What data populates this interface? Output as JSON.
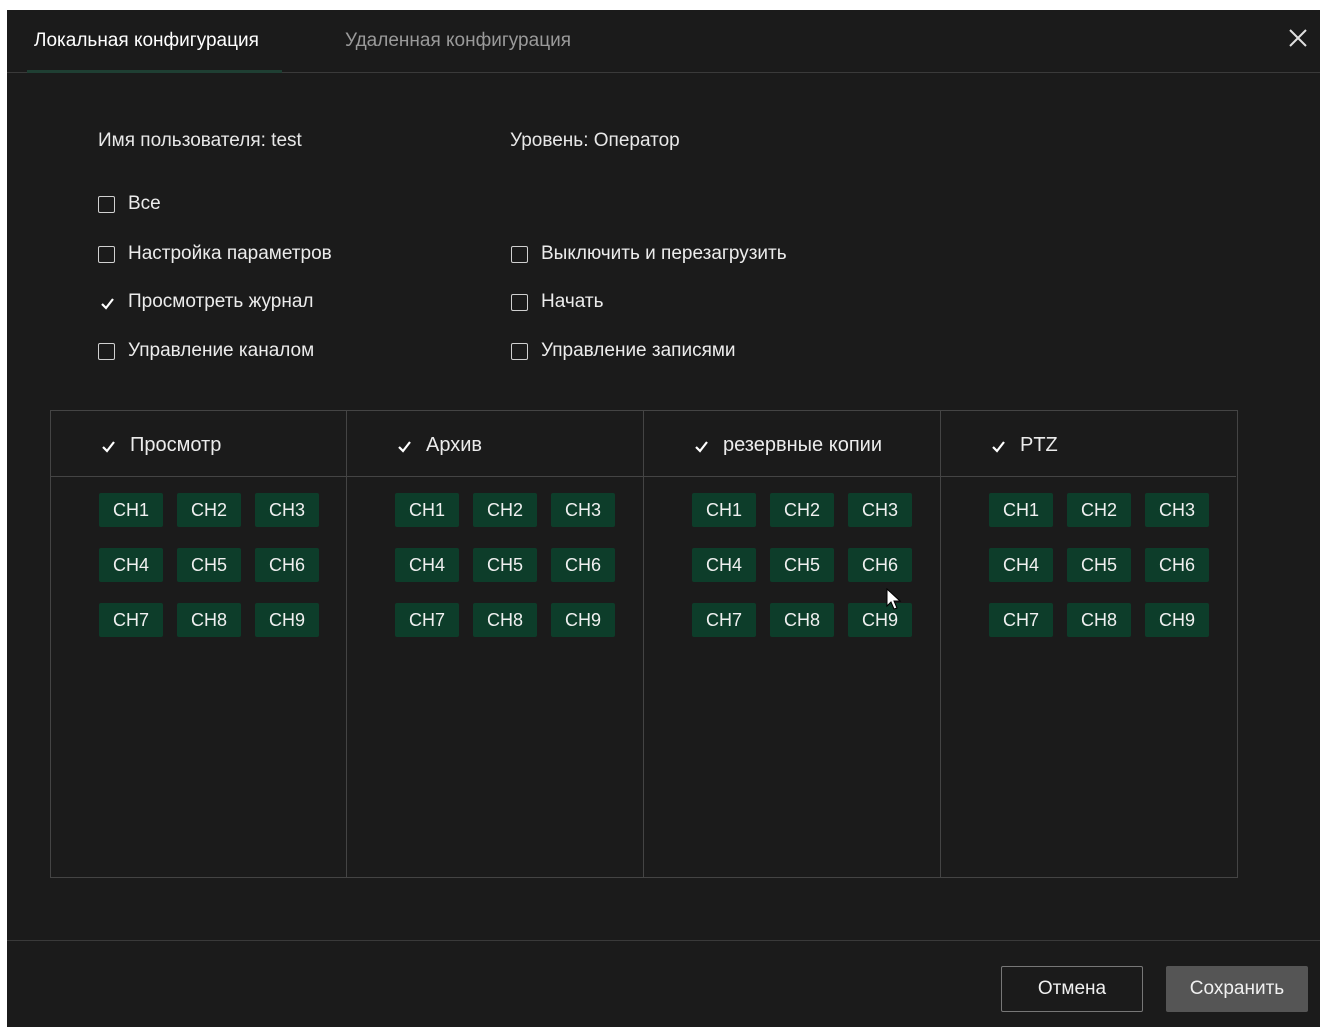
{
  "tabs": [
    {
      "label": "Локальная конфигурация",
      "active": true
    },
    {
      "label": "Удаленная конфигурация",
      "active": false
    }
  ],
  "close_icon": "close-icon",
  "info": {
    "user": "Имя пользователя: test",
    "level": "Уровень: Оператор"
  },
  "permissions": {
    "all": {
      "label": "Все",
      "checked": false
    },
    "settings": {
      "label": "Настройка параметров",
      "checked": false
    },
    "log": {
      "label": "Просмотреть журнал",
      "checked": true
    },
    "channel": {
      "label": "Управление каналом",
      "checked": false
    },
    "shutdown": {
      "label": "Выключить и перезагрузить",
      "checked": false
    },
    "start": {
      "label": "Начать",
      "checked": false
    },
    "records": {
      "label": "Управление записями",
      "checked": false
    }
  },
  "channel_groups": [
    {
      "title": "Просмотр",
      "checked": true
    },
    {
      "title": "Архив",
      "checked": true
    },
    {
      "title": "резервные копии",
      "checked": true
    },
    {
      "title": "PTZ",
      "checked": true
    }
  ],
  "channels": [
    "CH1",
    "CH2",
    "CH3",
    "CH4",
    "CH5",
    "CH6",
    "CH7",
    "CH8",
    "CH9"
  ],
  "footer": {
    "cancel": "Отмена",
    "save": "Сохранить"
  },
  "colors": {
    "background": "#1b1b1b",
    "chip": "#0d3d2a",
    "save_button": "#555555"
  }
}
